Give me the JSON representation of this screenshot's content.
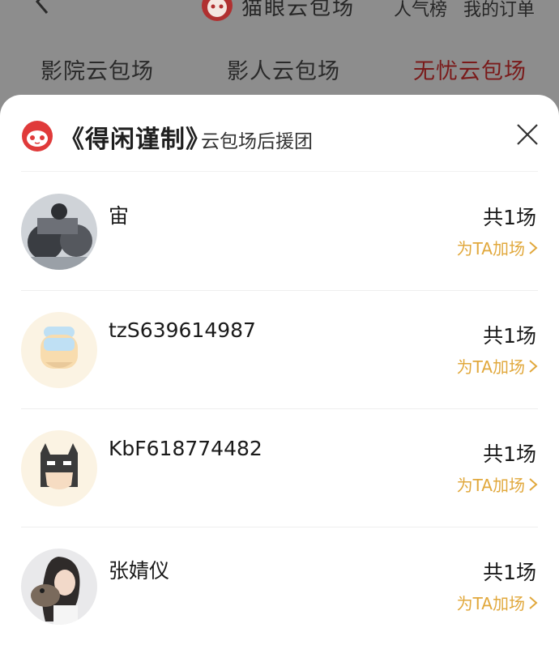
{
  "header": {
    "brand": "猫眼云包场",
    "links": [
      "人气榜",
      "我的订单"
    ]
  },
  "tabs": [
    {
      "label": "影院云包场",
      "active": false
    },
    {
      "label": "影人云包场",
      "active": false
    },
    {
      "label": "无忧云包场",
      "active": true
    }
  ],
  "sheet": {
    "title": "《得闲谨制》",
    "subtitle": "云包场后援团",
    "items": [
      {
        "name": "宙",
        "count": "共1场",
        "action": "为TA加场"
      },
      {
        "name": "tzS639614987",
        "count": "共1场",
        "action": "为TA加场"
      },
      {
        "name": "KbF618774482",
        "count": "共1场",
        "action": "为TA加场"
      },
      {
        "name": "张婧仪",
        "count": "共1场",
        "action": "为TA加场"
      }
    ]
  },
  "colors": {
    "brand_red": "#e03a3a",
    "action_gold": "#e1a83c",
    "overlay_gray": "#8d8d8d",
    "active_tab": "#7a1a1a"
  }
}
